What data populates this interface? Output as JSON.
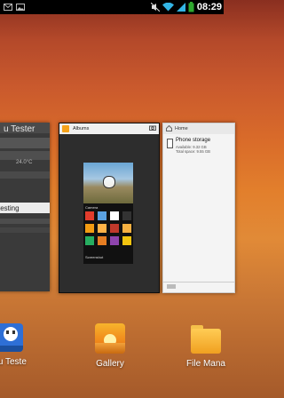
{
  "status_bar": {
    "time": "08:29",
    "icons": [
      "mail-icon",
      "image-icon",
      "mute-icon",
      "wifi-icon",
      "signal-icon",
      "battery-icon"
    ],
    "battery_color": "#2ea82e"
  },
  "recents": {
    "left_card": {
      "title": "u Tester",
      "button_label": "testing",
      "reading": "24.0°C"
    },
    "center_card": {
      "app_name": "Albums",
      "grid_labels": [
        "Camera",
        "Screenshot"
      ]
    },
    "right_card": {
      "breadcrumb": "Home",
      "storage_title": "Phone storage",
      "available": "Available: 9.32 GB",
      "total": "Total space: 9.55 GB"
    }
  },
  "dock": [
    {
      "label": "Tu Teste",
      "icon": "tu-tester-icon"
    },
    {
      "label": "Gallery",
      "icon": "gallery-icon"
    },
    {
      "label": "File Mana",
      "icon": "file-manager-icon"
    }
  ]
}
